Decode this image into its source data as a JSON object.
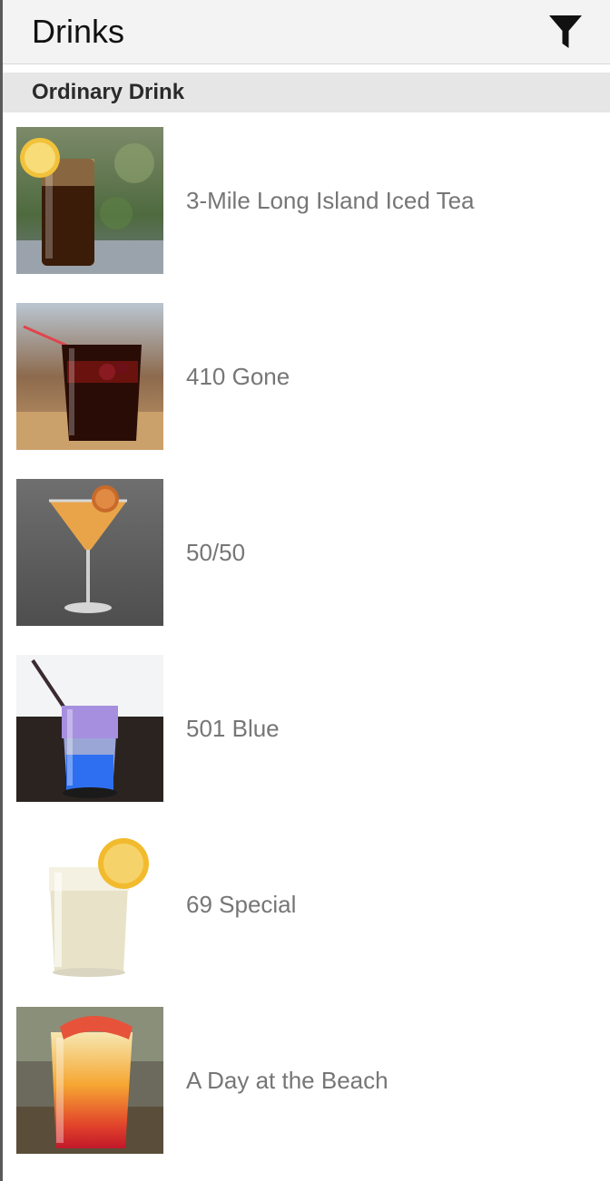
{
  "app_bar": {
    "title": "Drinks",
    "filter_icon": "filter-icon"
  },
  "section": {
    "title": "Ordinary Drink"
  },
  "drinks": [
    {
      "name": "3-Mile Long Island Iced Tea",
      "image": "iced-tea-glass-photo"
    },
    {
      "name": "410 Gone",
      "image": "dark-cocktail-glass-photo"
    },
    {
      "name": "50/50",
      "image": "martini-glass-photo"
    },
    {
      "name": "501 Blue",
      "image": "blue-layered-drink-photo"
    },
    {
      "name": "69 Special",
      "image": "lemon-highball-photo"
    },
    {
      "name": "A Day at the Beach",
      "image": "sunrise-layered-drink-photo"
    }
  ]
}
